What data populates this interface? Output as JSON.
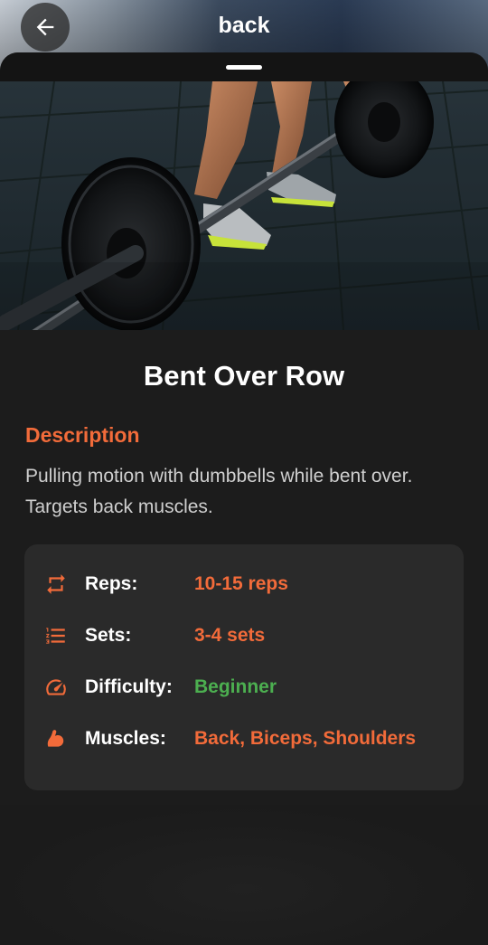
{
  "header": {
    "title": "back"
  },
  "exercise": {
    "name": "Bent Over Row"
  },
  "description": {
    "heading": "Description",
    "text": "Pulling motion with dumbbells while bent over. Targets back muscles."
  },
  "details": [
    {
      "icon": "repeat-icon",
      "label": "Reps:",
      "value": "10-15 reps",
      "color": "#f26b3a"
    },
    {
      "icon": "list-numbered-icon",
      "label": "Sets:",
      "value": "3-4 sets",
      "color": "#f26b3a"
    },
    {
      "icon": "speedometer-icon",
      "label": "Difficulty:",
      "value": "Beginner",
      "color": "#4caf50"
    },
    {
      "icon": "flexed-bicep-icon",
      "label": "Muscles:",
      "value": "Back, Biceps, Shoulders",
      "color": "#f26b3a"
    }
  ],
  "colors": {
    "accent": "#f26b3a",
    "success": "#4caf50",
    "background": "#1c1c1c",
    "card": "#2a2a2a"
  }
}
